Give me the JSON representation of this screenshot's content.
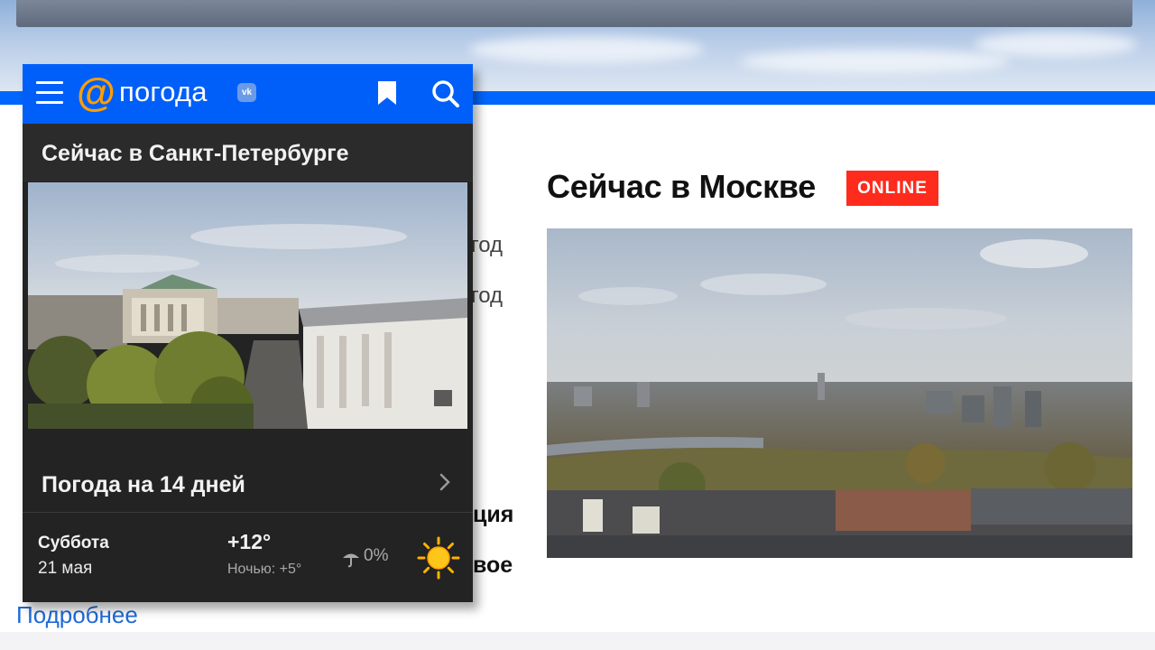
{
  "page": {
    "heading": "Сейчас в Москве",
    "online_badge": "ONLINE",
    "partial_texts": [
      "год",
      "год"
    ],
    "partial_bold": [
      "ция",
      "вое"
    ],
    "more_link": "Подробнее"
  },
  "widget": {
    "logo_at": "@",
    "logo_text": "погода",
    "logo_badge": "vk",
    "title": "Сейчас в Санкт-Петербурге",
    "forecast_link": "Погода на 14 дней",
    "day": {
      "name": "Суббота",
      "date": "21 мая",
      "temp_day": "+12°",
      "temp_night": "Ночью: +5°",
      "precipitation": "0%",
      "condition_icon": "sun-icon"
    }
  },
  "colors": {
    "header_blue": "#005ff9",
    "online_red": "#ff2b1c",
    "logo_orange": "#ff9e00",
    "widget_dark": "#232323",
    "link_blue": "#1f6ad8"
  }
}
